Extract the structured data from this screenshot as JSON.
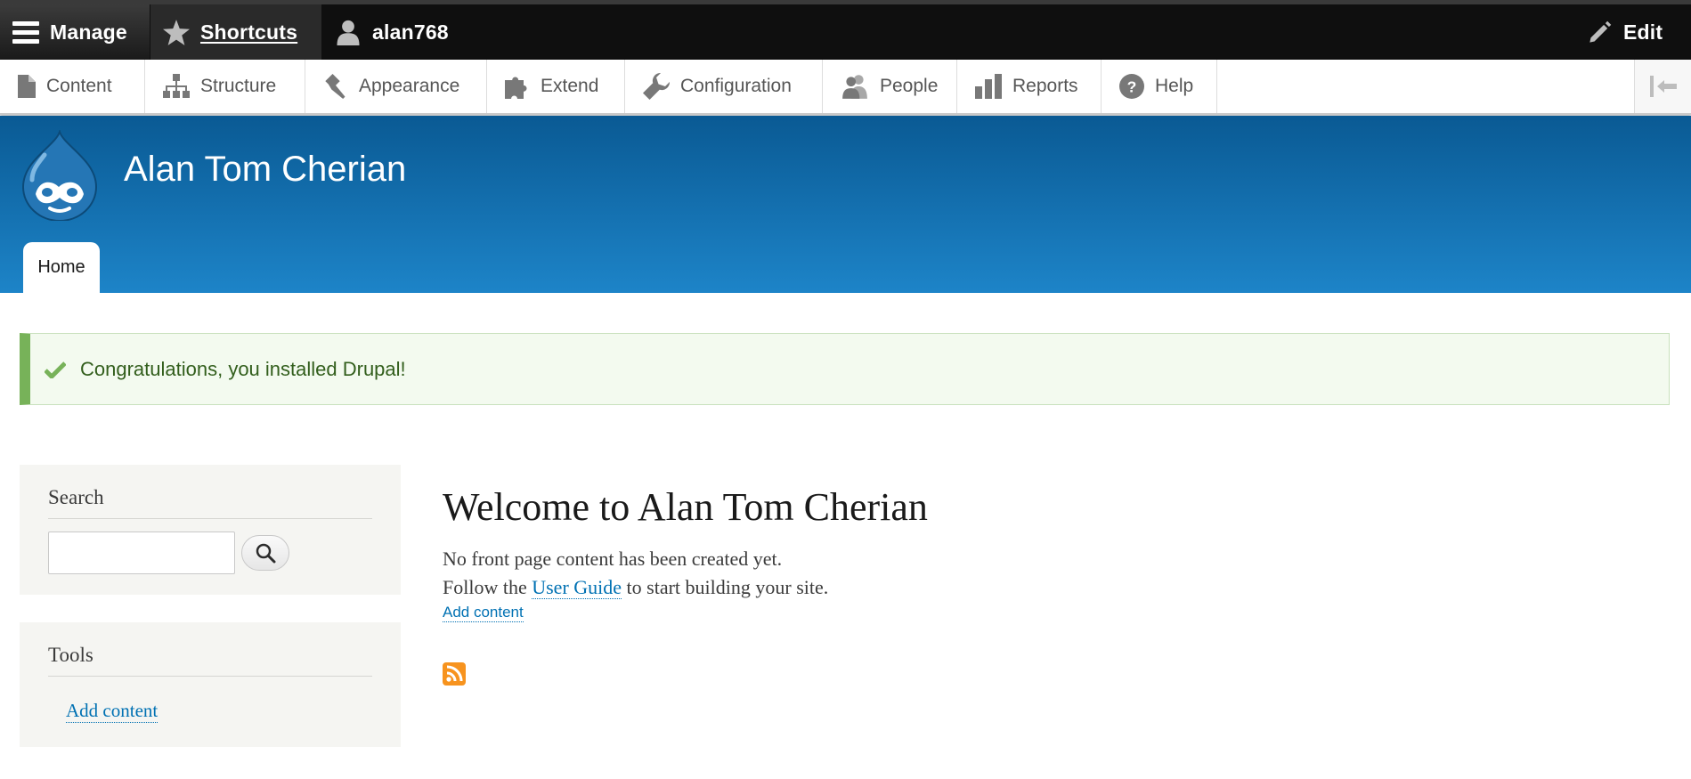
{
  "toolbar": {
    "manage_label": "Manage",
    "shortcuts_label": "Shortcuts",
    "user_label": "alan768",
    "edit_label": "Edit"
  },
  "tray": {
    "items": [
      {
        "label": "Content",
        "icon": "file-icon"
      },
      {
        "label": "Structure",
        "icon": "sitemap-icon"
      },
      {
        "label": "Appearance",
        "icon": "paintbrush-icon"
      },
      {
        "label": "Extend",
        "icon": "puzzle-icon"
      },
      {
        "label": "Configuration",
        "icon": "wrench-icon"
      },
      {
        "label": "People",
        "icon": "people-icon"
      },
      {
        "label": "Reports",
        "icon": "bar-chart-icon"
      },
      {
        "label": "Help",
        "icon": "help-icon"
      }
    ],
    "collapse_icon": "orientation-toggle-icon"
  },
  "header": {
    "site_name": "Alan Tom Cherian",
    "tabs": [
      {
        "label": "Home"
      }
    ]
  },
  "status": {
    "message": "Congratulations, you installed Drupal!",
    "color": "#77b259"
  },
  "sidebar": {
    "search": {
      "title": "Search",
      "input_value": "",
      "button_icon": "search-icon"
    },
    "tools": {
      "title": "Tools",
      "links": [
        {
          "label": "Add content"
        }
      ]
    }
  },
  "main": {
    "title": "Welcome to Alan Tom Cherian",
    "para1": "No front page content has been created yet.",
    "para2_before": "Follow the ",
    "para2_link": "User Guide",
    "para2_after": " to start building your site.",
    "add_content_link": "Add content",
    "feed_icon": "rss-feed-icon"
  },
  "colors": {
    "toolbar_bg": "#0f0f0f",
    "header_top": "#0a5a94",
    "header_bottom": "#1d84c8",
    "link": "#0071b3",
    "feed": "#f7931e"
  }
}
